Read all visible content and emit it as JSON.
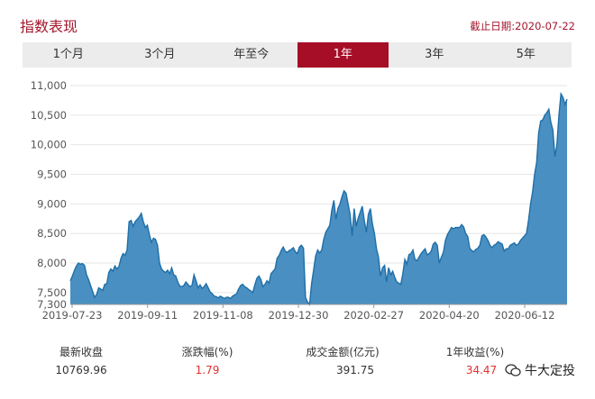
{
  "header": {
    "title": "指数表现",
    "as_of": "截止日期:2020-07-22"
  },
  "tabs": [
    {
      "label": "1个月",
      "active": false
    },
    {
      "label": "3个月",
      "active": false
    },
    {
      "label": "年至今",
      "active": false
    },
    {
      "label": "1年",
      "active": true
    },
    {
      "label": "3年",
      "active": false
    },
    {
      "label": "5年",
      "active": false
    }
  ],
  "colors": {
    "brand": "#a60d27",
    "area_fill": "#4a8fc1",
    "area_line": "#1e6fa8",
    "positive": "#e2302f"
  },
  "chart_data": {
    "type": "area",
    "ylim": [
      7300,
      11000
    ],
    "y_ticks": [
      "7,300",
      "7,500",
      "8,000",
      "8,500",
      "9,000",
      "9,500",
      "10,000",
      "10,500",
      "11,000"
    ],
    "y_tick_values": [
      7300,
      7500,
      8000,
      8500,
      9000,
      9500,
      10000,
      10500,
      11000
    ],
    "x_ticks": [
      "2019-07-23",
      "2019-09-11",
      "2019-11-08",
      "2019-12-30",
      "2020-02-27",
      "2020-04-20",
      "2020-06-12"
    ],
    "grid": true,
    "series": [
      {
        "values": [
          7700,
          7780,
          7870,
          7950,
          8000,
          7980,
          7990,
          7960,
          7800,
          7720,
          7620,
          7520,
          7420,
          7470,
          7580,
          7560,
          7540,
          7640,
          7650,
          7840,
          7900,
          7860,
          7950,
          7900,
          7940,
          8080,
          8160,
          8130,
          8220,
          8700,
          8720,
          8620,
          8700,
          8740,
          8780,
          8840,
          8700,
          8600,
          8640,
          8480,
          8350,
          8420,
          8400,
          8300,
          8000,
          7900,
          7860,
          7840,
          7880,
          7820,
          7920,
          7800,
          7780,
          7680,
          7610,
          7600,
          7620,
          7680,
          7640,
          7600,
          7620,
          7800,
          7700,
          7580,
          7630,
          7570,
          7600,
          7650,
          7580,
          7510,
          7480,
          7440,
          7430,
          7410,
          7440,
          7420,
          7400,
          7420,
          7420,
          7400,
          7440,
          7460,
          7480,
          7560,
          7620,
          7640,
          7600,
          7580,
          7550,
          7530,
          7500,
          7630,
          7740,
          7780,
          7720,
          7600,
          7640,
          7700,
          7660,
          7820,
          7860,
          7900,
          8080,
          8130,
          8210,
          8270,
          8200,
          8180,
          8210,
          8230,
          8260,
          8190,
          8160,
          8270,
          8300,
          8250,
          7420,
          7340,
          7300,
          7650,
          7880,
          8120,
          8220,
          8170,
          8220,
          8400,
          8520,
          8580,
          8640,
          8900,
          9060,
          8740,
          8920,
          9000,
          9120,
          9220,
          9180,
          9000,
          8820,
          8460,
          8920,
          8620,
          8760,
          8860,
          8960,
          8720,
          8520,
          8820,
          8920,
          8660,
          8500,
          8240,
          8100,
          7780,
          7920,
          7960,
          7680,
          7920,
          7800,
          7860,
          7760,
          7680,
          7660,
          7640,
          7820,
          8060,
          7980,
          8140,
          8160,
          8220,
          8060,
          8040,
          8100,
          8160,
          8200,
          8240,
          8140,
          8160,
          8200,
          8320,
          8350,
          8300,
          8000,
          8100,
          8180,
          8380,
          8480,
          8540,
          8600,
          8580,
          8600,
          8600,
          8600,
          8650,
          8610,
          8500,
          8450,
          8250,
          8210,
          8190,
          8230,
          8250,
          8300,
          8460,
          8480,
          8440,
          8380,
          8300,
          8260,
          8300,
          8320,
          8360,
          8340,
          8320,
          8200,
          8240,
          8240,
          8300,
          8320,
          8340,
          8300,
          8320,
          8380,
          8420,
          8460,
          8500,
          8720,
          9000,
          9200,
          9500,
          9700,
          10200,
          10400,
          10420,
          10500,
          10540,
          10600,
          10380,
          10250,
          9800,
          10000,
          10500,
          10860,
          10800,
          10680,
          10769.96
        ]
      }
    ]
  },
  "stats": [
    {
      "label": "最新收盘",
      "value": "10769.96",
      "highlight": false
    },
    {
      "label": "涨跌幅(%)",
      "value": "1.79",
      "highlight": true
    },
    {
      "label": "成交金额(亿元)",
      "value": "391.75",
      "highlight": false
    },
    {
      "label": "1年收益(%)",
      "value": "34.47",
      "highlight": true
    }
  ],
  "watermark": {
    "text": "牛大定投"
  }
}
